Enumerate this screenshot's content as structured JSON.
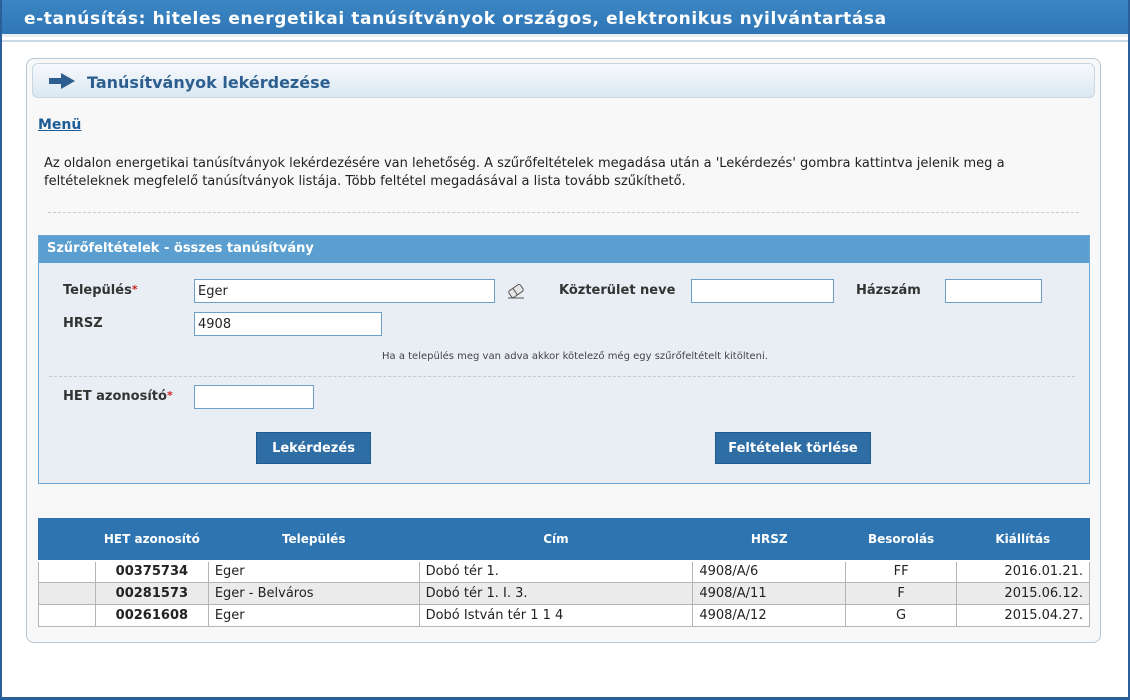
{
  "app": {
    "title": "e-tanúsítás: hiteles energetikai tanúsítványok országos, elektronikus nyilvántartása"
  },
  "page": {
    "heading": "Tanúsítványok lekérdezése",
    "menu_link": "Menü",
    "intro": "Az oldalon energetikai tanúsítványok lekérdezésére van lehetőség. A szűrőfeltételek megadása után a 'Lekérdezés' gombra kattintva jelenik meg a feltételeknek megfelelő tanúsítványok listája. Több feltétel megadásával a lista tovább szűkíthető."
  },
  "filter": {
    "header": "Szűrőfeltételek - összes tanúsítvány",
    "telepules_label": "Település",
    "telepules_value": "Eger",
    "required_mark": "*",
    "kozterulet_label": "Közterület neve",
    "kozterulet_value": "",
    "hazszam_label": "Házszám",
    "hazszam_value": "",
    "hrsz_label": "HRSZ",
    "hrsz_value": "4908",
    "hint": "Ha a település meg van adva akkor kötelező még egy szűrőfeltételt kitölteni.",
    "het_label": "HET azonosító",
    "het_value": "",
    "query_button": "Lekérdezés",
    "clear_button": "Feltételek törlése"
  },
  "results": {
    "columns": [
      "",
      "HET azonosító",
      "Település",
      "Cím",
      "HRSZ",
      "Besorolás",
      "Kiállítás"
    ],
    "rows": [
      [
        "",
        "00375734",
        "Eger",
        "Dobó tér 1.",
        "4908/A/6",
        "FF",
        "2016.01.21."
      ],
      [
        "",
        "00281573",
        "Eger - Belváros",
        "Dobó tér 1. I. 3.",
        "4908/A/11",
        "F",
        "2015.06.12."
      ],
      [
        "",
        "00261608",
        "Eger",
        "Dobó István tér 1 1 4",
        "4908/A/12",
        "G",
        "2015.04.27."
      ]
    ]
  },
  "icons": {
    "page_arrow": "arrow-right-icon",
    "eraser": "eraser-icon"
  },
  "colors": {
    "brand": "#2f76b5",
    "header_text": "#2c5f8f",
    "button": "#2e6ea5",
    "table_header": "#2e74b0"
  }
}
